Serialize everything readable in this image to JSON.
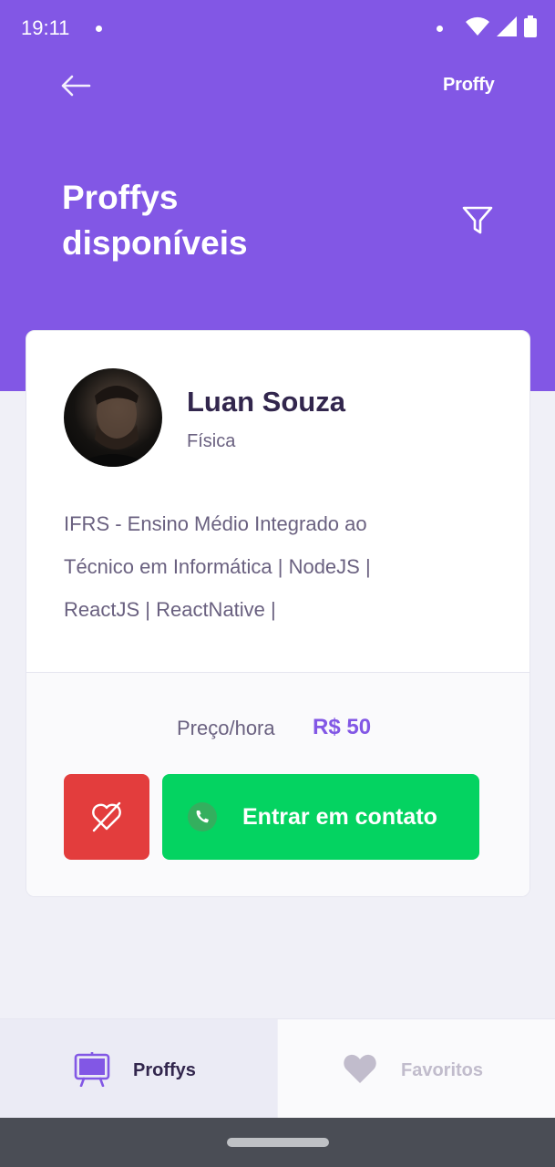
{
  "status_bar": {
    "time": "19:11"
  },
  "header": {
    "brand": "Proffy",
    "title_line1": "Proffys",
    "title_line2": "disponíveis"
  },
  "teacher": {
    "name": "Luan Souza",
    "subject": "Física",
    "bio_line1": "IFRS - Ensino Médio Integrado ao",
    "bio_line2": "Técnico em Informática | NodeJS |",
    "bio_line3": "ReactJS | ReactNative |",
    "price_label": "Preço/hora",
    "price_value": "R$ 50",
    "contact_label": "Entrar em contato"
  },
  "tabs": [
    {
      "label": "Proffys",
      "icon": "easel-icon",
      "active": true
    },
    {
      "label": "Favoritos",
      "icon": "heart-icon",
      "active": false
    }
  ],
  "colors": {
    "primary": "#8257E5",
    "background": "#F0F0F7",
    "title": "#32264D",
    "text": "#6A6180",
    "danger": "#E33D3D",
    "success": "#04D361",
    "nav_bar": "#4A4D55"
  }
}
